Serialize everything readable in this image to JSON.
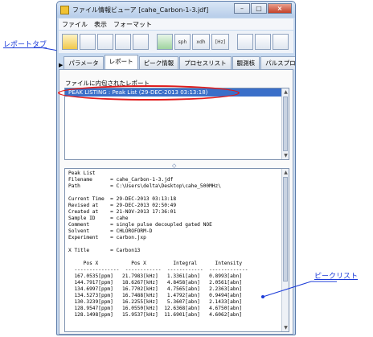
{
  "window": {
    "title": "ファイル情報ビューア [cahe_Carbon-1-3.jdf]",
    "buttons": [
      "–",
      "□",
      "×"
    ]
  },
  "menu": [
    "ファイル",
    "表示",
    "フォーマット"
  ],
  "toolbar": {
    "labels": [
      "",
      "",
      "",
      "",
      "",
      "",
      "sph",
      "xdh",
      "[Hz]",
      "",
      "",
      ""
    ],
    "icons": [
      "open-folder-icon",
      "open-file-icon",
      "report-icon",
      "save-icon",
      "print-icon",
      "spectrum-icon",
      "sph-icon",
      "xdh-icon",
      "hz-icon",
      "layout-one-icon",
      "layout-two-icon",
      "layout-three-icon"
    ]
  },
  "tabs": [
    {
      "label": "パラメータ",
      "active": false
    },
    {
      "label": "レポート",
      "active": true
    },
    {
      "label": "ピーク情報",
      "active": false
    },
    {
      "label": "プロセスリスト",
      "active": false
    },
    {
      "label": "観測核",
      "active": false
    },
    {
      "label": "パルスプログラム",
      "active": false
    }
  ],
  "report_section": {
    "label": "ファイルに内包されたレポート",
    "items": [
      "PEAK LISTING : Peak List  (29-DEC-2013 03:13:18)"
    ]
  },
  "peak_list": {
    "header_lines": [
      "Peak List",
      "Filename      = cahe_Carbon-1-3.jdf",
      "Path          = C:\\Users\\delta\\Desktop\\cahe_500MHz\\",
      "",
      "Current Time  = 29-DEC-2013 03:13:18",
      "Revised at    = 29-DEC-2013 02:50:49",
      "Created at    = 21-NOV-2013 17:36:01",
      "Sample ID     = cahe",
      "Comment       = single pulse decoupled gated NOE",
      "Solvent       = CHLOROFORM-D",
      "Experiment    = carbon.jxp",
      "",
      "X Title       = Carbon13",
      "",
      "     Pos X           Pos X         Integral      Intensity",
      "  ---------------  ------------  ------------  -------------"
    ],
    "rows": [
      [
        "167.0535[ppm]",
        "21.7983[kHz]",
        "1.3361[abn]",
        "0.8993[abn]"
      ],
      [
        "144.7917[ppm]",
        "18.6267[kHz]",
        "4.8458[abn]",
        "2.0561[abn]"
      ],
      [
        "134.6997[ppm]",
        "16.7702[kHz]",
        "4.7565[abn]",
        "2.2363[abn]"
      ],
      [
        "134.5273[ppm]",
        "16.7488[kHz]",
        "1.4792[abn]",
        "0.9494[abn]"
      ],
      [
        "130.3239[ppm]",
        "16.2255[kHz]",
        "5.3607[abn]",
        "2.1433[abn]"
      ],
      [
        "128.9547[ppm]",
        "16.0550[kHz]",
        "12.6368[abn]",
        "4.6750[abn]"
      ],
      [
        "128.1498[ppm]",
        "15.9537[kHz]",
        "11.6901[abn]",
        "4.6062[abn]"
      ]
    ]
  },
  "annotations": {
    "report_tab": "レポートタブ",
    "peak_list": "ピークリスト",
    "color": "#1a3ad8",
    "highlight_color": "#e01b1b"
  }
}
